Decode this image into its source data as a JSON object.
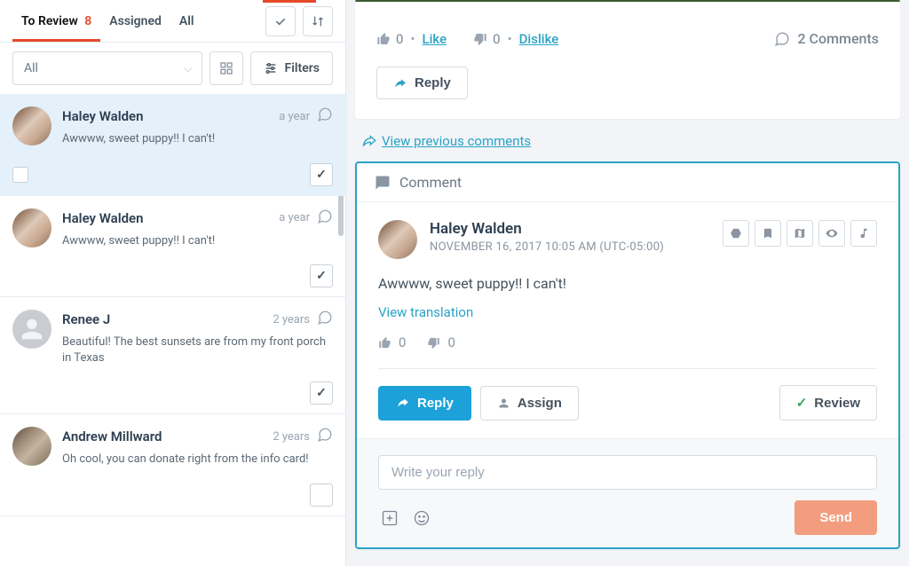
{
  "tabs": {
    "to_review": "To Review",
    "to_review_count": "8",
    "assigned": "Assigned",
    "all": "All"
  },
  "filter": {
    "selected": "All",
    "filters_label": "Filters"
  },
  "list": {
    "items": [
      {
        "name": "Haley Walden",
        "text": "Awwww, sweet puppy!! I can't!",
        "time": "a year",
        "selected": true,
        "checked": true,
        "avatar": "photo1",
        "show_select": true
      },
      {
        "name": "Haley Walden",
        "text": "Awwww, sweet puppy!! I can't!",
        "time": "a year",
        "selected": false,
        "checked": true,
        "avatar": "photo1",
        "show_select": false
      },
      {
        "name": "Renee J",
        "text": "Beautiful! The best sunsets are from my front porch in Texas",
        "time": "2 years",
        "selected": false,
        "checked": true,
        "avatar": "default",
        "show_select": false
      },
      {
        "name": "Andrew Millward",
        "text": "Oh cool, you can donate right from the info card!",
        "time": "2 years",
        "selected": false,
        "checked": false,
        "avatar": "photo4",
        "show_select": false
      }
    ]
  },
  "post": {
    "like_count": "0",
    "like_label": "Like",
    "dislike_count": "0",
    "dislike_label": "Dislike",
    "comments_label": "2 Comments",
    "reply_label": "Reply"
  },
  "view_previous": "View previous comments",
  "comment": {
    "header": "Comment",
    "name": "Haley Walden",
    "date": "NOVEMBER 16, 2017 10:05 AM (UTC-05:00)",
    "text": "Awwww, sweet puppy!! I can't!",
    "translate": "View translation",
    "up": "0",
    "down": "0",
    "reply_btn": "Reply",
    "assign_btn": "Assign",
    "review_btn": "Review"
  },
  "reply": {
    "placeholder": "Write your reply",
    "send": "Send"
  }
}
